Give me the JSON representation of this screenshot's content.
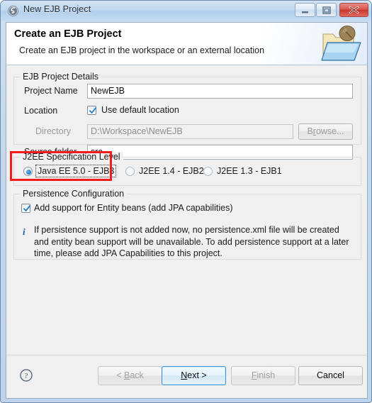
{
  "window": {
    "title": "New EJB Project",
    "icon": "eclipse-wizard-icon",
    "controls": {
      "minimize": "minimize-icon",
      "maximize": "maximize-icon",
      "close": "close-icon"
    }
  },
  "header": {
    "title": "Create an EJB Project",
    "subtitle": "Create an EJB project in the workspace or an external location",
    "icon": "ejb-project-folder-icon"
  },
  "details_group": {
    "legend": "EJB Project Details",
    "project_name_label": "Project Name",
    "project_name_value": "NewEJB",
    "location_label": "Location",
    "use_default_location_label": "Use default location",
    "use_default_location_checked": true,
    "directory_label": "Directory",
    "directory_value": "D:\\Workspace\\NewEJB",
    "browse_label": "Browse...",
    "browse_enabled": false,
    "source_folder_label": "Source folder",
    "source_folder_value": "src"
  },
  "spec_group": {
    "legend": "J2EE Specification Level",
    "options": [
      {
        "label": "Java EE 5.0 - EJB3",
        "selected": true,
        "focused": true
      },
      {
        "label": "J2EE 1.4 - EJB2",
        "selected": false,
        "focused": false
      },
      {
        "label": "J2EE 1.3 - EJB1",
        "selected": false,
        "focused": false
      }
    ]
  },
  "persistence_group": {
    "legend": "Persistence Configuration",
    "checkbox_label": "Add support for Entity beans (add JPA capabilities)",
    "checkbox_checked": true,
    "info_icon": "info-icon",
    "info_text": "If persistence support is not added now, no persistence.xml file will be created and entity bean support will be unavailable. To add persistence support at a later time, please add JPA Capabilities to this project."
  },
  "annotation": {
    "color": "#f21b1b",
    "target": "J2EE Specification Level"
  },
  "footer": {
    "help_icon": "help-question-icon",
    "buttons": [
      {
        "name": "back",
        "label": "< Back",
        "enabled": false,
        "default": false
      },
      {
        "name": "next",
        "label": "Next >",
        "enabled": true,
        "default": true
      },
      {
        "name": "finish",
        "label": "Finish",
        "enabled": false,
        "default": false
      },
      {
        "name": "cancel",
        "label": "Cancel",
        "enabled": true,
        "default": false
      }
    ]
  }
}
